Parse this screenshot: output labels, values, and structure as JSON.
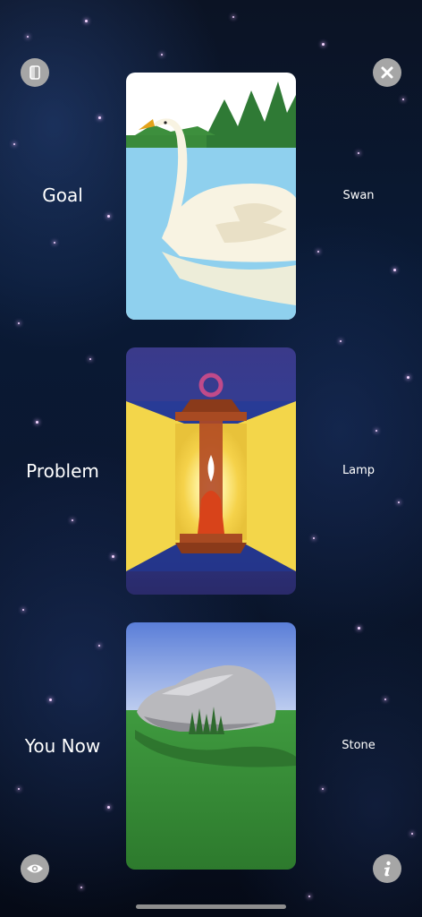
{
  "rows": [
    {
      "position_label": "Goal",
      "card_name": "Swan"
    },
    {
      "position_label": "Problem",
      "card_name": "Lamp"
    },
    {
      "position_label": "You Now",
      "card_name": "Stone"
    }
  ],
  "icons": {
    "top_left": "layout-toggle-icon",
    "top_right": "close-icon",
    "bottom_left": "eye-icon",
    "bottom_right": "info-icon"
  },
  "colors": {
    "button_fill": "#a6a6a6",
    "label_text": "#ffffff"
  }
}
